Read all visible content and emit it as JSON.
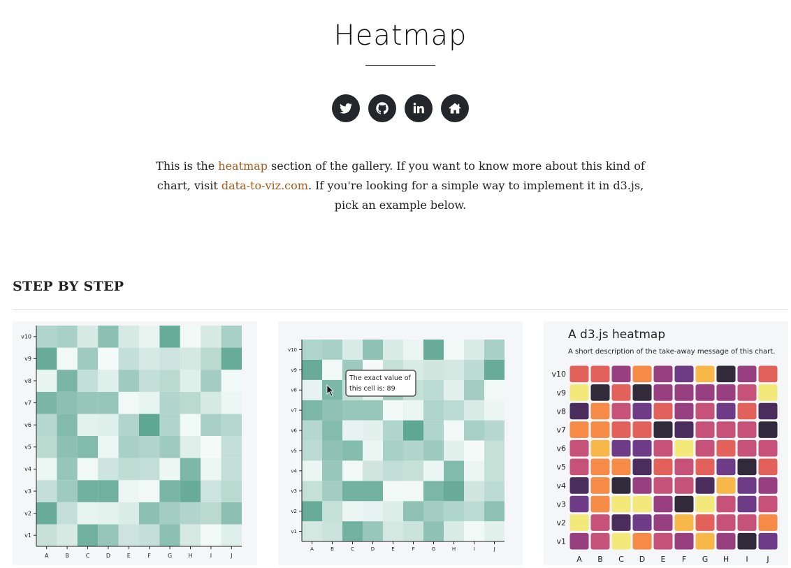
{
  "page": {
    "title": "Heatmap"
  },
  "social": [
    {
      "icon": "twitter-icon"
    },
    {
      "icon": "github-icon"
    },
    {
      "icon": "linkedin-icon"
    },
    {
      "icon": "home-icon"
    }
  ],
  "intro": {
    "part1": "This is the ",
    "link1": "heatmap",
    "part2": " section of the gallery. If you want to know more about this kind of chart, visit ",
    "link2": "data-to-viz.com",
    "part3": ". If you're looking for a simple way to implement it in d3.js, pick an example below."
  },
  "section": {
    "title": "STEP BY STEP"
  },
  "colors": {
    "link": "#a85a1b",
    "green_scale": [
      "#f5fbf9",
      "#5ea791"
    ],
    "plasma_like": [
      "#312a3b",
      "#4b2d5d",
      "#6e3b87",
      "#983f80",
      "#c6527a",
      "#e2615a",
      "#f58b46",
      "#f8b849",
      "#f3e87a"
    ]
  },
  "cards": [
    {
      "kind": "basic",
      "chart_data": {
        "type": "heatmap",
        "x": [
          "A",
          "B",
          "C",
          "D",
          "E",
          "F",
          "G",
          "H",
          "I",
          "J"
        ],
        "y": [
          "v1",
          "v2",
          "v3",
          "v4",
          "v5",
          "v6",
          "v7",
          "v8",
          "v9",
          "v10"
        ],
        "values": [
          [
            28,
            20,
            75,
            55,
            25,
            30,
            60,
            20,
            5,
            15
          ],
          [
            80,
            30,
            10,
            12,
            18,
            60,
            48,
            40,
            35,
            60
          ],
          [
            30,
            50,
            75,
            75,
            8,
            5,
            70,
            80,
            25,
            35
          ],
          [
            8,
            55,
            5,
            25,
            32,
            30,
            8,
            68,
            8,
            30
          ],
          [
            35,
            60,
            65,
            8,
            45,
            40,
            50,
            15,
            3,
            30
          ],
          [
            38,
            65,
            12,
            15,
            40,
            85,
            40,
            5,
            45,
            38
          ],
          [
            70,
            60,
            55,
            55,
            5,
            10,
            40,
            35,
            20,
            8
          ],
          [
            10,
            70,
            30,
            15,
            50,
            30,
            35,
            15,
            48,
            5
          ],
          [
            80,
            5,
            50,
            3,
            30,
            20,
            25,
            22,
            35,
            80
          ],
          [
            40,
            45,
            20,
            60,
            20,
            10,
            80,
            5,
            20,
            45
          ]
        ],
        "xlabel": "",
        "ylabel": ""
      }
    },
    {
      "kind": "tooltip",
      "tooltip_line1": "The exact value of",
      "tooltip_line2": "this cell is: 89",
      "chart_data": {
        "type": "heatmap",
        "x": [
          "A",
          "B",
          "C",
          "D",
          "E",
          "F",
          "G",
          "H",
          "I",
          "J"
        ],
        "y": [
          "v1",
          "v2",
          "v3",
          "v4",
          "v5",
          "v6",
          "v7",
          "v8",
          "v9",
          "v10"
        ],
        "values": [
          [
            20,
            25,
            70,
            50,
            20,
            25,
            55,
            18,
            5,
            12
          ],
          [
            75,
            28,
            8,
            10,
            15,
            55,
            45,
            38,
            32,
            55
          ],
          [
            28,
            45,
            70,
            70,
            5,
            5,
            65,
            75,
            22,
            32
          ],
          [
            8,
            50,
            5,
            22,
            30,
            28,
            8,
            62,
            8,
            28
          ],
          [
            32,
            55,
            60,
            8,
            42,
            38,
            48,
            12,
            3,
            28
          ],
          [
            35,
            60,
            10,
            12,
            38,
            80,
            38,
            5,
            42,
            35
          ],
          [
            65,
            55,
            50,
            50,
            5,
            8,
            38,
            32,
            18,
            8
          ],
          [
            10,
            65,
            28,
            12,
            48,
            28,
            32,
            12,
            45,
            5
          ],
          [
            75,
            5,
            48,
            3,
            28,
            18,
            22,
            20,
            32,
            75
          ],
          [
            38,
            42,
            18,
            55,
            18,
            8,
            75,
            5,
            18,
            42
          ]
        ],
        "xlabel": "",
        "ylabel": ""
      }
    },
    {
      "kind": "styled",
      "title": "A d3.js heatmap",
      "subtitle": "A short description of the take-away message of this chart.",
      "chart_data": {
        "type": "heatmap",
        "x": [
          "A",
          "B",
          "C",
          "D",
          "E",
          "F",
          "G",
          "H",
          "I",
          "J"
        ],
        "y": [
          "v1",
          "v2",
          "v3",
          "v4",
          "v5",
          "v6",
          "v7",
          "v8",
          "v9",
          "v10"
        ],
        "values": [
          [
            3,
            4,
            9,
            7,
            4,
            3,
            8,
            3,
            0,
            2
          ],
          [
            9,
            4,
            1,
            2,
            3,
            8,
            6,
            5,
            5,
            7
          ],
          [
            2,
            7,
            9,
            9,
            3,
            0,
            9,
            5,
            2,
            4
          ],
          [
            1,
            7,
            0,
            3,
            5,
            5,
            1,
            8,
            2,
            3
          ],
          [
            5,
            7,
            7,
            1,
            6,
            4,
            6,
            2,
            0,
            6
          ],
          [
            4,
            8,
            2,
            2,
            5,
            9,
            5,
            6,
            5,
            5
          ],
          [
            7,
            7,
            6,
            6,
            0,
            1,
            5,
            5,
            4,
            0
          ],
          [
            1,
            7,
            5,
            2,
            6,
            3,
            5,
            2,
            6,
            1
          ],
          [
            9,
            0,
            6,
            0,
            3,
            3,
            3,
            3,
            5,
            9
          ],
          [
            6,
            6,
            3,
            7,
            3,
            2,
            8,
            0,
            3,
            6
          ]
        ],
        "xlabel": "",
        "ylabel": ""
      }
    }
  ]
}
